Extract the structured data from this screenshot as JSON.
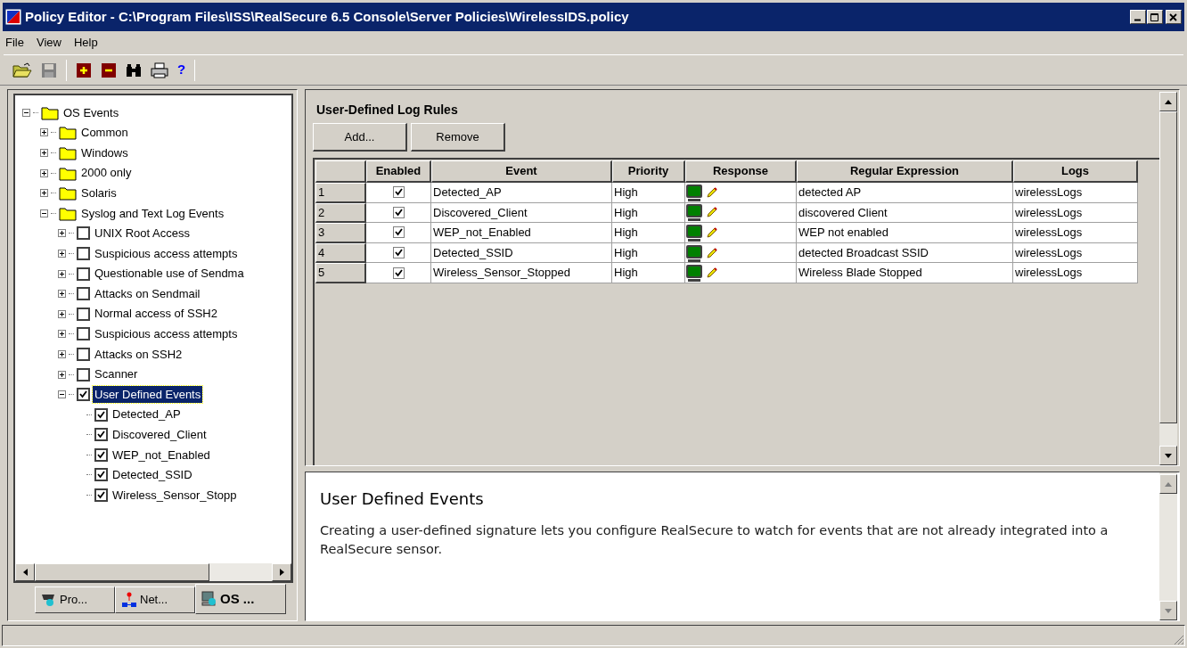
{
  "window": {
    "title": "Policy Editor - C:\\Program Files\\ISS\\RealSecure 6.5 Console\\Server Policies\\WirelessIDS.policy"
  },
  "menu": [
    "File",
    "View",
    "Help"
  ],
  "toolbar": {
    "help_label": "?",
    "save_disabled": true
  },
  "tree": [
    {
      "label": "OS Events",
      "kind": "folder",
      "expanded": true,
      "selected": false,
      "children": [
        {
          "label": "Common",
          "kind": "folder",
          "expanded": false,
          "selected": false
        },
        {
          "label": "Windows",
          "kind": "folder",
          "expanded": false,
          "selected": false
        },
        {
          "label": "2000 only",
          "kind": "folder",
          "expanded": false,
          "selected": false
        },
        {
          "label": "Solaris",
          "kind": "folder",
          "expanded": false,
          "selected": false
        },
        {
          "label": "Syslog and Text Log Events",
          "kind": "folder",
          "expanded": true,
          "selected": false,
          "children": [
            {
              "label": "UNIX Root Access",
              "kind": "check",
              "checked": false,
              "expanded": false,
              "selected": false
            },
            {
              "label": "Suspicious access attempts",
              "kind": "check",
              "checked": false,
              "expanded": false,
              "selected": false
            },
            {
              "label": "Questionable use of Sendma",
              "kind": "check",
              "checked": false,
              "expanded": false,
              "selected": false
            },
            {
              "label": "Attacks on Sendmail",
              "kind": "check",
              "checked": false,
              "expanded": false,
              "selected": false
            },
            {
              "label": "Normal access of SSH2",
              "kind": "check",
              "checked": false,
              "expanded": false,
              "selected": false
            },
            {
              "label": "Suspicious access attempts",
              "kind": "check",
              "checked": false,
              "expanded": false,
              "selected": false
            },
            {
              "label": "Attacks on SSH2",
              "kind": "check",
              "checked": false,
              "expanded": false,
              "selected": false
            },
            {
              "label": "Scanner",
              "kind": "check",
              "checked": false,
              "expanded": false,
              "selected": false
            },
            {
              "label": "User Defined Events",
              "kind": "check",
              "checked": true,
              "expanded": true,
              "selected": true,
              "children": [
                {
                  "label": "Detected_AP",
                  "kind": "check",
                  "checked": true,
                  "selected": false
                },
                {
                  "label": "Discovered_Client",
                  "kind": "check",
                  "checked": true,
                  "selected": false
                },
                {
                  "label": "WEP_not_Enabled",
                  "kind": "check",
                  "checked": true,
                  "selected": false
                },
                {
                  "label": "Detected_SSID",
                  "kind": "check",
                  "checked": true,
                  "selected": false
                },
                {
                  "label": "Wireless_Sensor_Stopp",
                  "kind": "check",
                  "checked": true,
                  "selected": false
                }
              ]
            }
          ]
        }
      ]
    }
  ],
  "tabs": [
    {
      "label": "Pro...",
      "selected": false
    },
    {
      "label": "Net...",
      "selected": false
    },
    {
      "label": "OS ...",
      "selected": true
    }
  ],
  "rules": {
    "title": "User-Defined Log Rules",
    "buttons": [
      "Add...",
      "Remove"
    ],
    "columns": [
      "Enabled",
      "Event",
      "Priority",
      "Response",
      "Regular Expression",
      "Logs"
    ],
    "rows": [
      {
        "number": "1",
        "enabled": true,
        "event": "Detected_AP",
        "priority": "High",
        "regex": "detected AP",
        "logs": "wirelessLogs"
      },
      {
        "number": "2",
        "enabled": true,
        "event": "Discovered_Client",
        "priority": "High",
        "regex": "discovered Client",
        "logs": "wirelessLogs"
      },
      {
        "number": "3",
        "enabled": true,
        "event": "WEP_not_Enabled",
        "priority": "High",
        "regex": "WEP not enabled",
        "logs": "wirelessLogs"
      },
      {
        "number": "4",
        "enabled": true,
        "event": "Detected_SSID",
        "priority": "High",
        "regex": "detected Broadcast SSID",
        "logs": "wirelessLogs"
      },
      {
        "number": "5",
        "enabled": true,
        "event": "Wireless_Sensor_Stopped",
        "priority": "High",
        "regex": "Wireless Blade Stopped",
        "logs": "wirelessLogs"
      }
    ]
  },
  "description": {
    "title": "User Defined Events",
    "body": "Creating a user-defined signature lets you configure RealSecure to watch for events that are not already integrated into a RealSecure sensor."
  }
}
